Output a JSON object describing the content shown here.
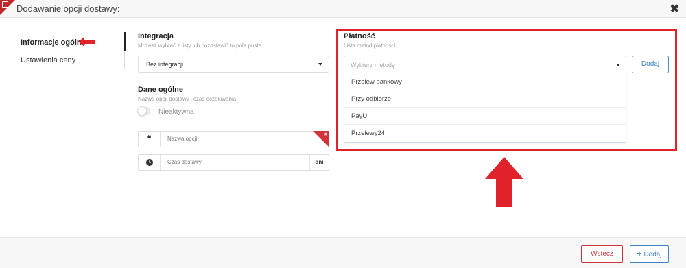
{
  "header": {
    "title": "Dodawanie opcji dostawy:",
    "close_glyph": "✖"
  },
  "nav": {
    "items": [
      {
        "label": "Informacje ogólne",
        "active": true
      },
      {
        "label": "Ustawienia ceny",
        "active": false
      }
    ]
  },
  "integration": {
    "title": "Integracja",
    "subtitle": "Możesz wybrać z listy lub pozostawić to pole puste",
    "selected": "Bez integracji"
  },
  "general": {
    "title": "Dane ogólne",
    "subtitle": "Nazwa opcji dostawy i czas oczekiwania",
    "toggle_label": "Nieaktywna",
    "toggle_on": false,
    "name_placeholder": "Nazwa opcji",
    "name_icon": "quote-icon",
    "required_mark": "*",
    "time_placeholder": "Czas dostawy",
    "time_icon": "clock-icon",
    "time_unit": "dni"
  },
  "payment": {
    "title": "Płatność",
    "subtitle": "Lista metod płatności",
    "placeholder": "Wybierz metodę",
    "options": [
      "Przelew bankowy",
      "Przy odbiorze",
      "PayU",
      "Przelewy24"
    ],
    "add_label": "Dodaj"
  },
  "footer": {
    "back_label": "Wstecz",
    "add_label": "Dodaj",
    "add_icon": "plus-icon"
  },
  "colors": {
    "accent_red": "#e0222a",
    "accent_blue": "#3a83c9",
    "header_bg": "#f7f7f7"
  }
}
